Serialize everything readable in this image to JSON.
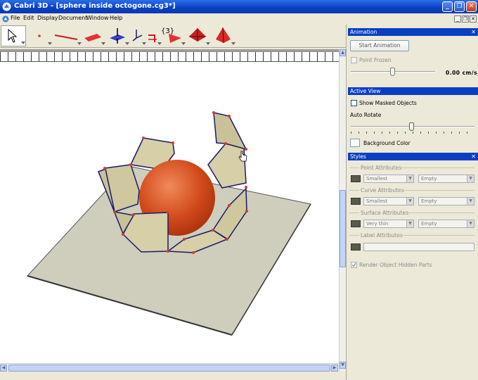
{
  "window": {
    "title": "Cabri 3D - [sphere inside octogone.cg3*]",
    "minimize_glyph": "_",
    "maximize_glyph": "❐",
    "close_glyph": "✕"
  },
  "menu": {
    "items": [
      "File",
      "Edit",
      "Display",
      "Document",
      "Window",
      "Help"
    ]
  },
  "toolbar": {
    "tools": [
      "pointer-tool",
      "point-tool",
      "line-tool",
      "plane-tool",
      "perpendicular-tool",
      "transformation-tool",
      "measurement-tool",
      "polygon-tool",
      "polyhedron-tool",
      "regular-polyhedron-tool"
    ],
    "measure_label": "{3}"
  },
  "panels": {
    "animation": {
      "header": "Animation",
      "start_button": "Start Animation",
      "point_frozen": "Point Frozen",
      "speed_value": "0.00 cm/s"
    },
    "active_view": {
      "header": "Active View",
      "show_masked": "Show Masked Objects",
      "auto_rotate": "Auto Rotate",
      "background_color": "Background Color"
    },
    "styles": {
      "header": "Styles",
      "point_attributes": "Point Attributes",
      "point_size": "Smallest",
      "point_style": "Empty",
      "curve_attributes": "Curve Attributes",
      "curve_thickness": "Smallest",
      "curve_style": "Empty",
      "surface_attributes": "Surface Attributes",
      "surface_thickness": "Very thin",
      "surface_style": "Empty",
      "label_attributes": "Label Attributes",
      "render_hidden": "Render Object Hidden Parts"
    }
  },
  "colors": {
    "titlebar": "#0a3fc4",
    "sphere": "#d24a1c",
    "plane": "#cfcdbc",
    "pentagon_fill": "#d6cfa8",
    "edge": "#1a1a66",
    "vertex": "#d33a2a"
  }
}
